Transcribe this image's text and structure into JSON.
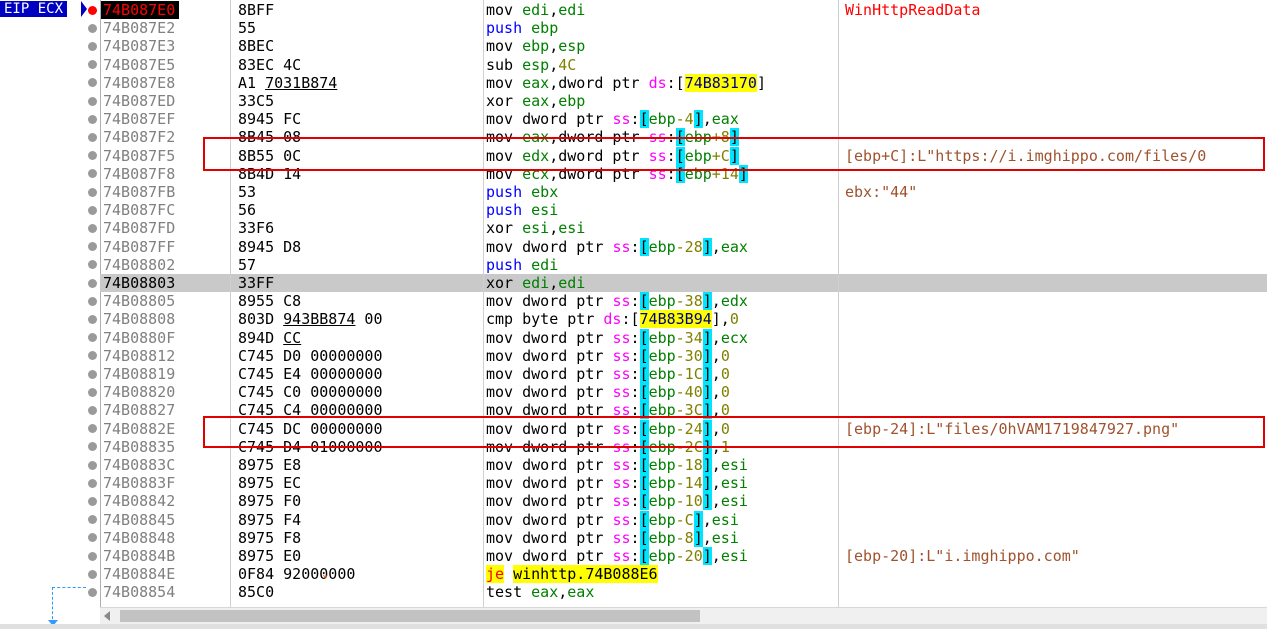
{
  "eip_label": "EIP ECX",
  "rows": [
    {
      "addr": "74B087E0",
      "bytes": "8BFF",
      "asm": [
        [
          "m",
          "mov"
        ],
        [
          "t",
          " "
        ],
        [
          "r",
          "edi"
        ],
        [
          "t",
          ","
        ],
        [
          "r",
          "edi"
        ]
      ],
      "comment": "WinHttpReadData",
      "cstyle": "api",
      "eip": true
    },
    {
      "addr": "74B087E2",
      "bytes": "55",
      "asm": [
        [
          "p",
          "push"
        ],
        [
          "t",
          " "
        ],
        [
          "r",
          "ebp"
        ]
      ],
      "comment": ""
    },
    {
      "addr": "74B087E3",
      "bytes": "8BEC",
      "asm": [
        [
          "m",
          "mov"
        ],
        [
          "t",
          " "
        ],
        [
          "r",
          "ebp"
        ],
        [
          "t",
          ","
        ],
        [
          "r",
          "esp"
        ]
      ],
      "comment": ""
    },
    {
      "addr": "74B087E5",
      "bytes": "83EC 4C",
      "asm": [
        [
          "m",
          "sub"
        ],
        [
          "t",
          " "
        ],
        [
          "r",
          "esp"
        ],
        [
          "t",
          ","
        ],
        [
          "i",
          "4C"
        ]
      ],
      "comment": ""
    },
    {
      "addr": "74B087E8",
      "bytes": "A1 ",
      "bytesu": "7031B874",
      "asm": [
        [
          "m",
          "mov"
        ],
        [
          "t",
          " "
        ],
        [
          "r",
          "eax"
        ],
        [
          "t",
          ","
        ],
        [
          "k",
          "dword ptr "
        ],
        [
          "s",
          "ds"
        ],
        [
          "t",
          ":["
        ],
        [
          "a",
          "74B83170"
        ],
        [
          "t",
          "]"
        ]
      ],
      "comment": ""
    },
    {
      "addr": "74B087ED",
      "bytes": "33C5",
      "asm": [
        [
          "m",
          "xor"
        ],
        [
          "t",
          " "
        ],
        [
          "r",
          "eax"
        ],
        [
          "t",
          ","
        ],
        [
          "r",
          "ebp"
        ]
      ],
      "comment": ""
    },
    {
      "addr": "74B087EF",
      "bytes": "8945 FC",
      "asm": [
        [
          "m",
          "mov"
        ],
        [
          "t",
          " "
        ],
        [
          "k",
          "dword ptr "
        ],
        [
          "s",
          "ss"
        ],
        [
          "t",
          ":"
        ],
        [
          "b",
          "["
        ],
        [
          "r",
          "ebp"
        ],
        [
          "o",
          "-4"
        ],
        [
          "b",
          "]"
        ],
        [
          "t",
          ","
        ],
        [
          "r",
          "eax"
        ]
      ],
      "comment": ""
    },
    {
      "addr": "74B087F2",
      "bytes": "8B45 08",
      "asm": [
        [
          "m",
          "mov"
        ],
        [
          "t",
          " "
        ],
        [
          "r",
          "eax"
        ],
        [
          "t",
          ","
        ],
        [
          "k",
          "dword ptr "
        ],
        [
          "s",
          "ss"
        ],
        [
          "t",
          ":"
        ],
        [
          "b",
          "["
        ],
        [
          "r",
          "ebp"
        ],
        [
          "o",
          "+8"
        ],
        [
          "b",
          "]"
        ]
      ],
      "comment": ""
    },
    {
      "addr": "74B087F5",
      "bytes": "8B55 0C",
      "asm": [
        [
          "m",
          "mov"
        ],
        [
          "t",
          " "
        ],
        [
          "r",
          "edx"
        ],
        [
          "t",
          ","
        ],
        [
          "k",
          "dword ptr "
        ],
        [
          "s",
          "ss"
        ],
        [
          "t",
          ":"
        ],
        [
          "b",
          "["
        ],
        [
          "r",
          "ebp"
        ],
        [
          "o",
          "+C"
        ],
        [
          "b",
          "]"
        ]
      ],
      "comment": "[ebp+C]:L\"https://i.imghippo.com/files/0"
    },
    {
      "addr": "74B087F8",
      "bytes": "8B4D 14",
      "asm": [
        [
          "m",
          "mov"
        ],
        [
          "t",
          " "
        ],
        [
          "r",
          "ecx"
        ],
        [
          "t",
          ","
        ],
        [
          "k",
          "dword ptr "
        ],
        [
          "s",
          "ss"
        ],
        [
          "t",
          ":"
        ],
        [
          "b",
          "["
        ],
        [
          "r",
          "ebp"
        ],
        [
          "o",
          "+14"
        ],
        [
          "b",
          "]"
        ]
      ],
      "comment": ""
    },
    {
      "addr": "74B087FB",
      "bytes": "53",
      "asm": [
        [
          "p",
          "push"
        ],
        [
          "t",
          " "
        ],
        [
          "r",
          "ebx"
        ]
      ],
      "comment": "ebx:\"44\""
    },
    {
      "addr": "74B087FC",
      "bytes": "56",
      "asm": [
        [
          "p",
          "push"
        ],
        [
          "t",
          " "
        ],
        [
          "r",
          "esi"
        ]
      ],
      "comment": ""
    },
    {
      "addr": "74B087FD",
      "bytes": "33F6",
      "asm": [
        [
          "m",
          "xor"
        ],
        [
          "t",
          " "
        ],
        [
          "r",
          "esi"
        ],
        [
          "t",
          ","
        ],
        [
          "r",
          "esi"
        ]
      ],
      "comment": ""
    },
    {
      "addr": "74B087FF",
      "bytes": "8945 D8",
      "asm": [
        [
          "m",
          "mov"
        ],
        [
          "t",
          " "
        ],
        [
          "k",
          "dword ptr "
        ],
        [
          "s",
          "ss"
        ],
        [
          "t",
          ":"
        ],
        [
          "b",
          "["
        ],
        [
          "r",
          "ebp"
        ],
        [
          "o",
          "-28"
        ],
        [
          "b",
          "]"
        ],
        [
          "t",
          ","
        ],
        [
          "r",
          "eax"
        ]
      ],
      "comment": ""
    },
    {
      "addr": "74B08802",
      "bytes": "57",
      "asm": [
        [
          "p",
          "push"
        ],
        [
          "t",
          " "
        ],
        [
          "r",
          "edi"
        ]
      ],
      "comment": ""
    },
    {
      "addr": "74B08803",
      "bytes": "33FF",
      "asm": [
        [
          "m",
          "xor"
        ],
        [
          "t",
          " "
        ],
        [
          "r",
          "edi"
        ],
        [
          "t",
          ","
        ],
        [
          "r",
          "edi"
        ]
      ],
      "comment": "",
      "sel": true
    },
    {
      "addr": "74B08805",
      "bytes": "8955 C8",
      "asm": [
        [
          "m",
          "mov"
        ],
        [
          "t",
          " "
        ],
        [
          "k",
          "dword ptr "
        ],
        [
          "s",
          "ss"
        ],
        [
          "t",
          ":"
        ],
        [
          "b",
          "["
        ],
        [
          "r",
          "ebp"
        ],
        [
          "o",
          "-38"
        ],
        [
          "b",
          "]"
        ],
        [
          "t",
          ","
        ],
        [
          "r",
          "edx"
        ]
      ],
      "comment": ""
    },
    {
      "addr": "74B08808",
      "bytes": "803D ",
      "bytesu": "943BB874",
      "bytes2": " 00",
      "asm": [
        [
          "m",
          "cmp"
        ],
        [
          "t",
          " "
        ],
        [
          "k",
          "byte ptr "
        ],
        [
          "s",
          "ds"
        ],
        [
          "t",
          ":["
        ],
        [
          "a",
          "74B83B94"
        ],
        [
          "t",
          "],"
        ],
        [
          "i",
          "0"
        ]
      ],
      "comment": ""
    },
    {
      "addr": "74B0880F",
      "bytes": "894D ",
      "bytesu": "CC",
      "asm": [
        [
          "m",
          "mov"
        ],
        [
          "t",
          " "
        ],
        [
          "k",
          "dword ptr "
        ],
        [
          "s",
          "ss"
        ],
        [
          "t",
          ":"
        ],
        [
          "b",
          "["
        ],
        [
          "r",
          "ebp"
        ],
        [
          "o",
          "-34"
        ],
        [
          "b",
          "]"
        ],
        [
          "t",
          ","
        ],
        [
          "r",
          "ecx"
        ]
      ],
      "comment": ""
    },
    {
      "addr": "74B08812",
      "bytes": "C745 D0 00000000",
      "asm": [
        [
          "m",
          "mov"
        ],
        [
          "t",
          " "
        ],
        [
          "k",
          "dword ptr "
        ],
        [
          "s",
          "ss"
        ],
        [
          "t",
          ":"
        ],
        [
          "b",
          "["
        ],
        [
          "r",
          "ebp"
        ],
        [
          "o",
          "-30"
        ],
        [
          "b",
          "]"
        ],
        [
          "t",
          ","
        ],
        [
          "i",
          "0"
        ]
      ],
      "comment": ""
    },
    {
      "addr": "74B08819",
      "bytes": "C745 E4 00000000",
      "asm": [
        [
          "m",
          "mov"
        ],
        [
          "t",
          " "
        ],
        [
          "k",
          "dword ptr "
        ],
        [
          "s",
          "ss"
        ],
        [
          "t",
          ":"
        ],
        [
          "b",
          "["
        ],
        [
          "r",
          "ebp"
        ],
        [
          "o",
          "-1C"
        ],
        [
          "b",
          "]"
        ],
        [
          "t",
          ","
        ],
        [
          "i",
          "0"
        ]
      ],
      "comment": ""
    },
    {
      "addr": "74B08820",
      "bytes": "C745 C0 00000000",
      "asm": [
        [
          "m",
          "mov"
        ],
        [
          "t",
          " "
        ],
        [
          "k",
          "dword ptr "
        ],
        [
          "s",
          "ss"
        ],
        [
          "t",
          ":"
        ],
        [
          "b",
          "["
        ],
        [
          "r",
          "ebp"
        ],
        [
          "o",
          "-40"
        ],
        [
          "b",
          "]"
        ],
        [
          "t",
          ","
        ],
        [
          "i",
          "0"
        ]
      ],
      "comment": ""
    },
    {
      "addr": "74B08827",
      "bytes": "C745 C4 00000000",
      "asm": [
        [
          "m",
          "mov"
        ],
        [
          "t",
          " "
        ],
        [
          "k",
          "dword ptr "
        ],
        [
          "s",
          "ss"
        ],
        [
          "t",
          ":"
        ],
        [
          "b",
          "["
        ],
        [
          "r",
          "ebp"
        ],
        [
          "o",
          "-3C"
        ],
        [
          "b",
          "]"
        ],
        [
          "t",
          ","
        ],
        [
          "i",
          "0"
        ]
      ],
      "comment": ""
    },
    {
      "addr": "74B0882E",
      "bytes": "C745 DC 00000000",
      "asm": [
        [
          "m",
          "mov"
        ],
        [
          "t",
          " "
        ],
        [
          "k",
          "dword ptr "
        ],
        [
          "s",
          "ss"
        ],
        [
          "t",
          ":"
        ],
        [
          "b",
          "["
        ],
        [
          "r",
          "ebp"
        ],
        [
          "o",
          "-24"
        ],
        [
          "b",
          "]"
        ],
        [
          "t",
          ","
        ],
        [
          "i",
          "0"
        ]
      ],
      "comment": "[ebp-24]:L\"files/0hVAM1719847927.png\""
    },
    {
      "addr": "74B08835",
      "bytes": "C745 D4 01000000",
      "asm": [
        [
          "m",
          "mov"
        ],
        [
          "t",
          " "
        ],
        [
          "k",
          "dword ptr "
        ],
        [
          "s",
          "ss"
        ],
        [
          "t",
          ":"
        ],
        [
          "b",
          "["
        ],
        [
          "r",
          "ebp"
        ],
        [
          "o",
          "-2C"
        ],
        [
          "b",
          "]"
        ],
        [
          "t",
          ","
        ],
        [
          "i",
          "1"
        ]
      ],
      "comment": ""
    },
    {
      "addr": "74B0883C",
      "bytes": "8975 E8",
      "asm": [
        [
          "m",
          "mov"
        ],
        [
          "t",
          " "
        ],
        [
          "k",
          "dword ptr "
        ],
        [
          "s",
          "ss"
        ],
        [
          "t",
          ":"
        ],
        [
          "b",
          "["
        ],
        [
          "r",
          "ebp"
        ],
        [
          "o",
          "-18"
        ],
        [
          "b",
          "]"
        ],
        [
          "t",
          ","
        ],
        [
          "r",
          "esi"
        ]
      ],
      "comment": ""
    },
    {
      "addr": "74B0883F",
      "bytes": "8975 EC",
      "asm": [
        [
          "m",
          "mov"
        ],
        [
          "t",
          " "
        ],
        [
          "k",
          "dword ptr "
        ],
        [
          "s",
          "ss"
        ],
        [
          "t",
          ":"
        ],
        [
          "b",
          "["
        ],
        [
          "r",
          "ebp"
        ],
        [
          "o",
          "-14"
        ],
        [
          "b",
          "]"
        ],
        [
          "t",
          ","
        ],
        [
          "r",
          "esi"
        ]
      ],
      "comment": ""
    },
    {
      "addr": "74B08842",
      "bytes": "8975 F0",
      "asm": [
        [
          "m",
          "mov"
        ],
        [
          "t",
          " "
        ],
        [
          "k",
          "dword ptr "
        ],
        [
          "s",
          "ss"
        ],
        [
          "t",
          ":"
        ],
        [
          "b",
          "["
        ],
        [
          "r",
          "ebp"
        ],
        [
          "o",
          "-10"
        ],
        [
          "b",
          "]"
        ],
        [
          "t",
          ","
        ],
        [
          "r",
          "esi"
        ]
      ],
      "comment": ""
    },
    {
      "addr": "74B08845",
      "bytes": "8975 F4",
      "asm": [
        [
          "m",
          "mov"
        ],
        [
          "t",
          " "
        ],
        [
          "k",
          "dword ptr "
        ],
        [
          "s",
          "ss"
        ],
        [
          "t",
          ":"
        ],
        [
          "b",
          "["
        ],
        [
          "r",
          "ebp"
        ],
        [
          "o",
          "-C"
        ],
        [
          "b",
          "]"
        ],
        [
          "t",
          ","
        ],
        [
          "r",
          "esi"
        ]
      ],
      "comment": ""
    },
    {
      "addr": "74B08848",
      "bytes": "8975 F8",
      "asm": [
        [
          "m",
          "mov"
        ],
        [
          "t",
          " "
        ],
        [
          "k",
          "dword ptr "
        ],
        [
          "s",
          "ss"
        ],
        [
          "t",
          ":"
        ],
        [
          "b",
          "["
        ],
        [
          "r",
          "ebp"
        ],
        [
          "o",
          "-8"
        ],
        [
          "b",
          "]"
        ],
        [
          "t",
          ","
        ],
        [
          "r",
          "esi"
        ]
      ],
      "comment": ""
    },
    {
      "addr": "74B0884B",
      "bytes": "8975 E0",
      "asm": [
        [
          "m",
          "mov"
        ],
        [
          "t",
          " "
        ],
        [
          "k",
          "dword ptr "
        ],
        [
          "s",
          "ss"
        ],
        [
          "t",
          ":"
        ],
        [
          "b",
          "["
        ],
        [
          "r",
          "ebp"
        ],
        [
          "o",
          "-20"
        ],
        [
          "b",
          "]"
        ],
        [
          "t",
          ","
        ],
        [
          "r",
          "esi"
        ]
      ],
      "comment": "[ebp-20]:L\"i.imghippo.com\""
    },
    {
      "addr": "74B0884E",
      "bytes": "0F84 92000000",
      "asm": [
        [
          "j",
          "je"
        ],
        [
          "t",
          " "
        ],
        [
          "g",
          "winhttp.74B088E6"
        ]
      ],
      "comment": "",
      "jmp": true
    },
    {
      "addr": "74B08854",
      "bytes": "85C0",
      "asm": [
        [
          "m",
          "test"
        ],
        [
          "t",
          " "
        ],
        [
          "r",
          "eax"
        ],
        [
          "t",
          ","
        ],
        [
          "r",
          "eax"
        ]
      ],
      "comment": ""
    }
  ],
  "colors": {
    "highlight_box": "#e00000",
    "eip_bg": "#0000c0",
    "selected_row": "#c9c9c9"
  }
}
